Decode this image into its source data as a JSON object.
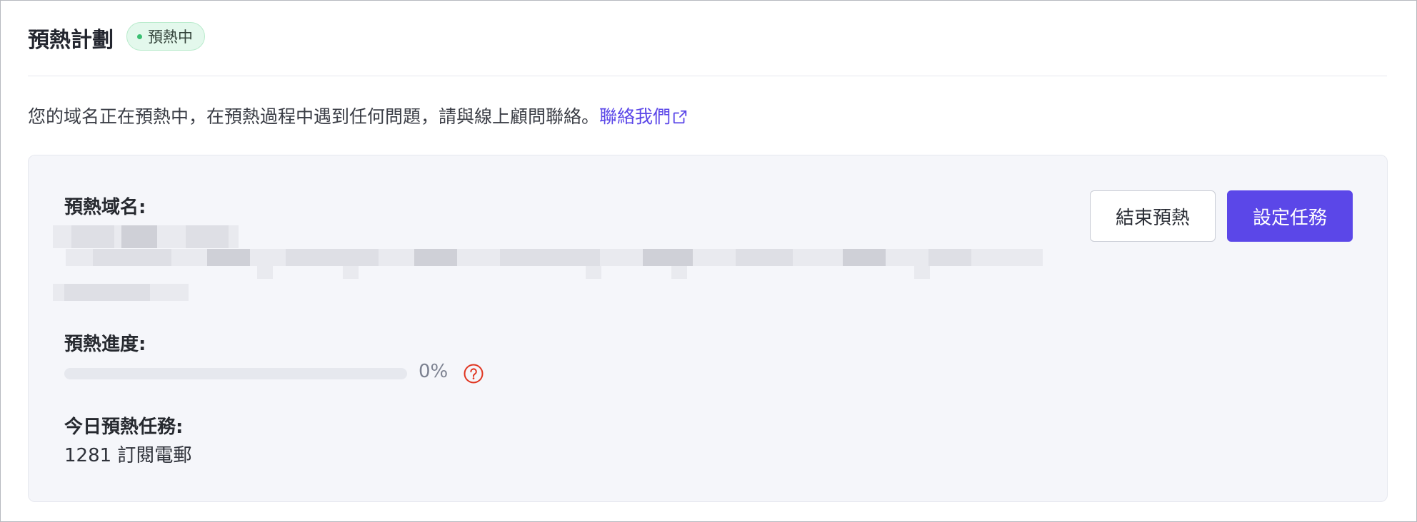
{
  "header": {
    "title": "預熱計劃",
    "status_badge": "預熱中"
  },
  "notice": {
    "text": "您的域名正在預熱中，在預熱過程中遇到任何問題，請與線上顧問聯絡。",
    "link_label": "聯絡我們",
    "link_icon": "external-link-icon"
  },
  "panel": {
    "domain_label": "預熱域名:",
    "progress_label": "預熱進度:",
    "progress_value": "0%",
    "progress_fraction": 0,
    "help_icon": "question-circle-icon",
    "task_label": "今日預熱任務:",
    "task_value": "1281 訂閱電郵"
  },
  "actions": {
    "end_label": "結束預熱",
    "set_label": "設定任務"
  },
  "colors": {
    "accent": "#5b47e8",
    "status_dot": "#3bbf72",
    "badge_bg": "#e3f8ec",
    "help_icon": "#e0341f",
    "panel_bg": "#f5f6fa"
  }
}
